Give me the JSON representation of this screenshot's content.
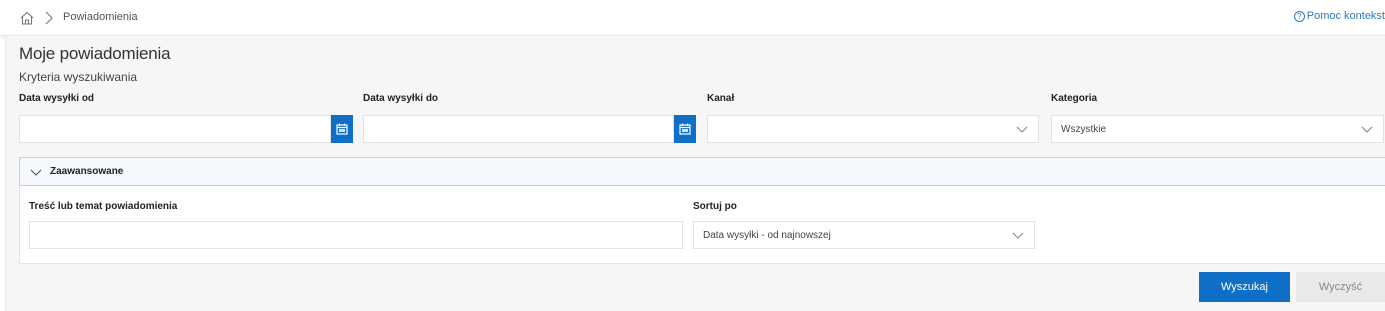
{
  "breadcrumb": {
    "home_icon": "home-icon",
    "separator_icon": "chevron-right-icon",
    "current": "Powiadomienia"
  },
  "help": {
    "icon": "question-circle-icon",
    "label": "Pomoc kontekst"
  },
  "page": {
    "title": "Moje powiadomienia",
    "subtitle": "Kryteria wyszukiwania"
  },
  "filters": {
    "date_from": {
      "label": "Data wysyłki od",
      "value": "",
      "icon": "calendar-icon"
    },
    "date_to": {
      "label": "Data wysyłki do",
      "value": "",
      "icon": "calendar-icon"
    },
    "channel": {
      "label": "Kanał",
      "value": "",
      "icon": "chevron-down-icon"
    },
    "category": {
      "label": "Kategoria",
      "value": "Wszystkie",
      "icon": "chevron-down-icon"
    }
  },
  "advanced": {
    "label": "Zaawansowane",
    "icon": "chevron-down-icon",
    "content_field": {
      "label": "Treść lub temat powiadomienia",
      "value": ""
    },
    "sort_field": {
      "label": "Sortuj po",
      "value": "Data wysyłki - od najnowszej"
    }
  },
  "actions": {
    "search_label": "Wyszukaj",
    "clear_label": "Wyczyść"
  },
  "colors": {
    "accent": "#0f6fc6",
    "link": "#2b79c2",
    "panel_bg": "#f6f6f6",
    "advanced_border": "#b9d3ee"
  }
}
